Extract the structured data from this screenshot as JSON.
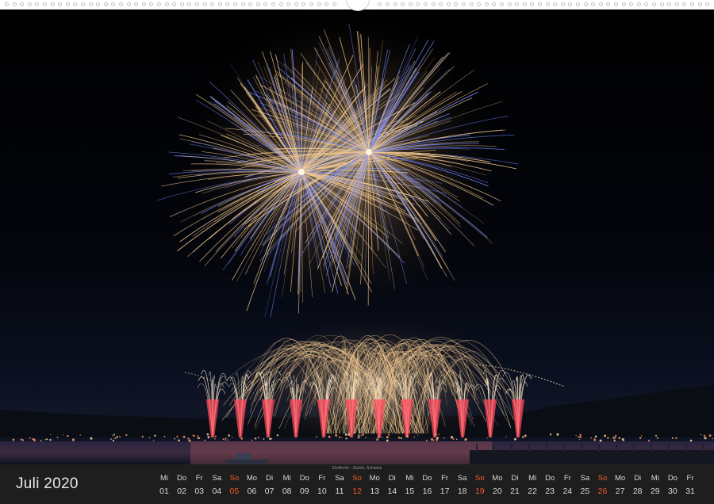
{
  "calendar": {
    "month_label": "Juli 2020",
    "caption": "Züriﬁscht - Zürich, Schweiz",
    "days": [
      {
        "wd": "Mi",
        "d": "01",
        "sun": false
      },
      {
        "wd": "Do",
        "d": "02",
        "sun": false
      },
      {
        "wd": "Fr",
        "d": "03",
        "sun": false
      },
      {
        "wd": "Sa",
        "d": "04",
        "sun": false
      },
      {
        "wd": "So",
        "d": "05",
        "sun": true
      },
      {
        "wd": "Mo",
        "d": "06",
        "sun": false
      },
      {
        "wd": "Di",
        "d": "07",
        "sun": false
      },
      {
        "wd": "Mi",
        "d": "08",
        "sun": false
      },
      {
        "wd": "Do",
        "d": "09",
        "sun": false
      },
      {
        "wd": "Fr",
        "d": "10",
        "sun": false
      },
      {
        "wd": "Sa",
        "d": "11",
        "sun": false
      },
      {
        "wd": "So",
        "d": "12",
        "sun": true
      },
      {
        "wd": "Mo",
        "d": "13",
        "sun": false
      },
      {
        "wd": "Di",
        "d": "14",
        "sun": false
      },
      {
        "wd": "Mi",
        "d": "15",
        "sun": false
      },
      {
        "wd": "Do",
        "d": "16",
        "sun": false
      },
      {
        "wd": "Fr",
        "d": "17",
        "sun": false
      },
      {
        "wd": "Sa",
        "d": "18",
        "sun": false
      },
      {
        "wd": "So",
        "d": "19",
        "sun": true
      },
      {
        "wd": "Mo",
        "d": "20",
        "sun": false
      },
      {
        "wd": "Di",
        "d": "21",
        "sun": false
      },
      {
        "wd": "Mi",
        "d": "22",
        "sun": false
      },
      {
        "wd": "Do",
        "d": "23",
        "sun": false
      },
      {
        "wd": "Fr",
        "d": "24",
        "sun": false
      },
      {
        "wd": "Sa",
        "d": "25",
        "sun": false
      },
      {
        "wd": "So",
        "d": "26",
        "sun": true
      },
      {
        "wd": "Mo",
        "d": "27",
        "sun": false
      },
      {
        "wd": "Di",
        "d": "28",
        "sun": false
      },
      {
        "wd": "Mi",
        "d": "29",
        "sun": false
      },
      {
        "wd": "Do",
        "d": "30",
        "sun": false
      },
      {
        "wd": "Fr",
        "d": "31",
        "sun": false
      }
    ]
  },
  "colors": {
    "sunday": "#f15a2b",
    "bar": "#1e1e1e",
    "firework_gold": "#f3c98f",
    "firework_blue": "#6f87ff",
    "firework_red": "#ff4a5c"
  }
}
